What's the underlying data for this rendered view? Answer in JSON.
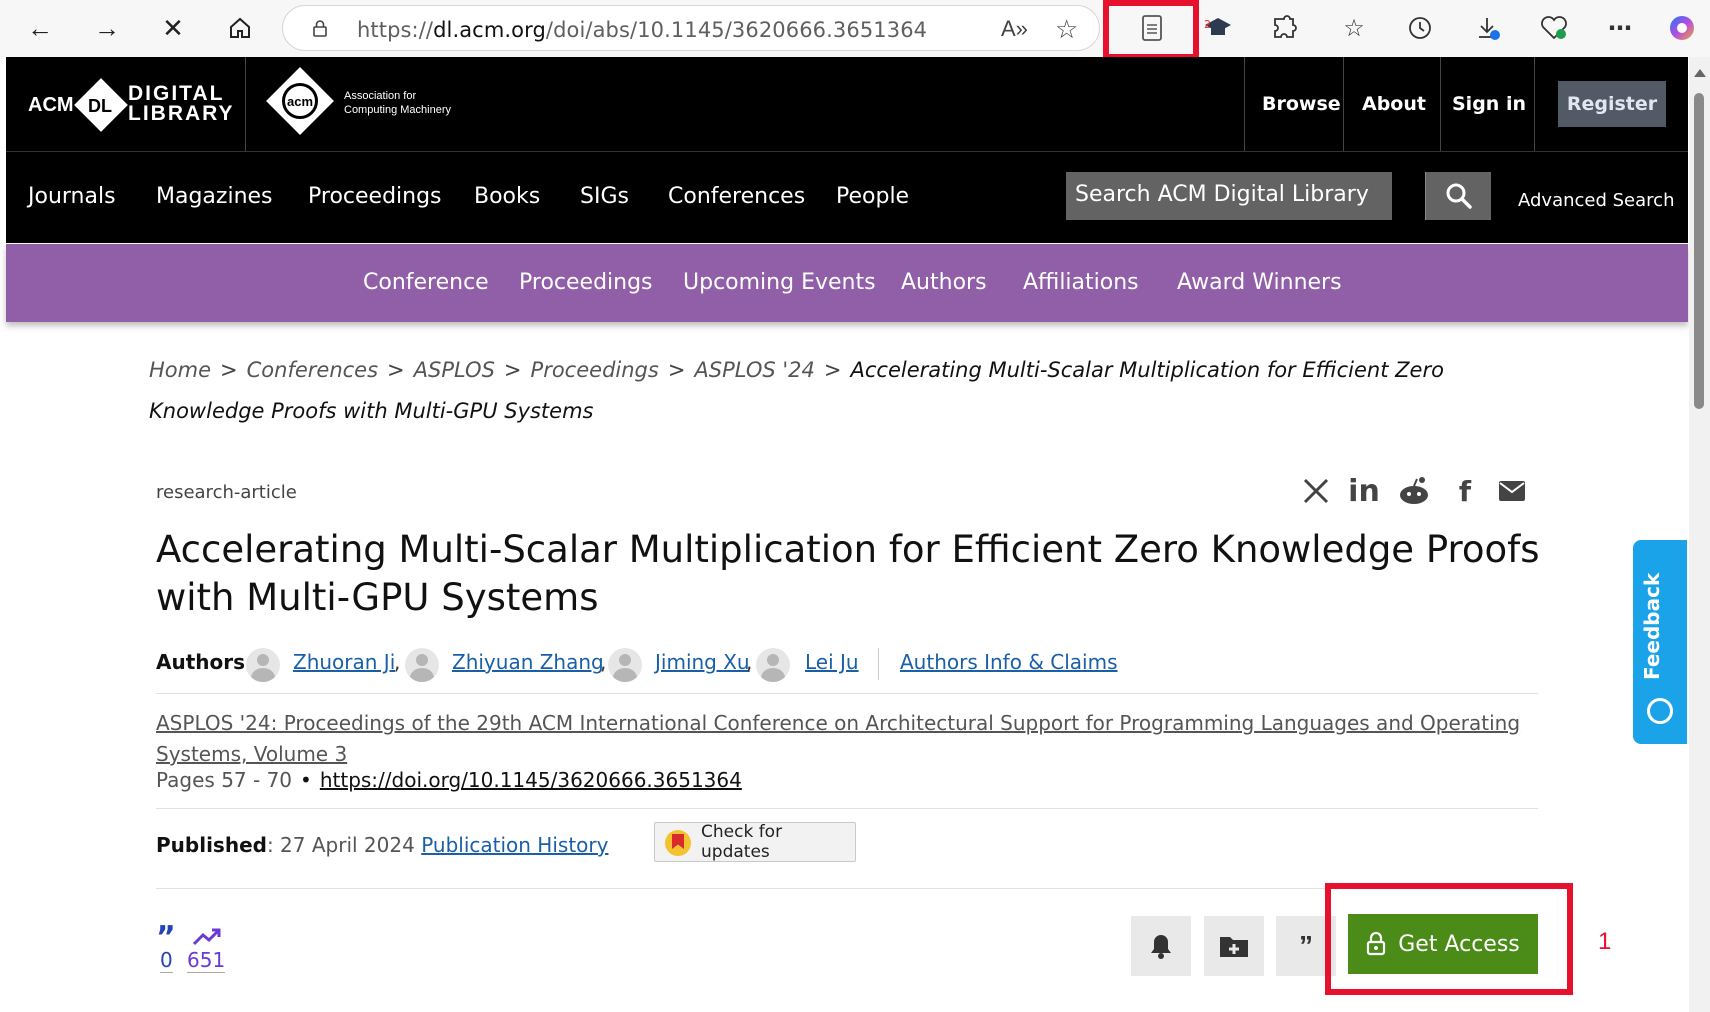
{
  "browser": {
    "url_prefix": "https://",
    "url_host": "dl.acm.org",
    "url_path": "/doi/abs/10.1145/3620666.3651364",
    "read_aloud": "A»"
  },
  "header": {
    "dl_logo_acm": "ACM",
    "dl_logo_mark": "DL",
    "dl_logo_digital": "DIGITAL",
    "dl_logo_library": "LIBRARY",
    "acm_logo_mark": "acm",
    "acm_line1": "Association for",
    "acm_line2": "Computing Machinery",
    "links": [
      "Browse",
      "About",
      "Sign in"
    ],
    "register": "Register"
  },
  "nav": {
    "items": [
      "Journals",
      "Magazines",
      "Proceedings",
      "Books",
      "SIGs",
      "Conferences",
      "People"
    ],
    "search_placeholder": "Search ACM Digital Library",
    "advanced_search": "Advanced Search"
  },
  "subnav": {
    "items": [
      "Conference",
      "Proceedings",
      "Upcoming Events",
      "Authors",
      "Affiliations",
      "Award Winners"
    ]
  },
  "breadcrumb": {
    "items": [
      "Home",
      "Conferences",
      "ASPLOS",
      "Proceedings",
      "ASPLOS '24"
    ],
    "current": "Accelerating Multi-Scalar Multiplication for Efficient Zero Knowledge Proofs with Multi-GPU Systems",
    "separator": ">"
  },
  "article": {
    "type": "research-article",
    "title": "Accelerating Multi-Scalar Multiplication for Efficient Zero Knowledge Proofs with Multi-GPU Systems",
    "authors_label": "Authors",
    "authors": [
      "Zhuoran Ji",
      "Zhiyuan Zhang",
      "Jiming Xu",
      "Lei Ju"
    ],
    "authors_info": "Authors Info & Claims",
    "proceedings": "ASPLOS '24: Proceedings of the 29th ACM International Conference on Architectural Support for Programming Languages and Operating Systems, Volume 3",
    "pages": "Pages 57 - 70",
    "bullet": "•",
    "doi": "https://doi.org/10.1145/3620666.3651364",
    "published_label": "Published",
    "published_date": ": 27 April 2024",
    "publication_history": "Publication History",
    "check_updates": "Check for updates",
    "citations": "0",
    "downloads": "651",
    "get_access": "Get Access"
  },
  "share_icons": [
    "x-icon",
    "linkedin-icon",
    "reddit-icon",
    "facebook-icon",
    "email-icon"
  ],
  "feedback": "Feedback",
  "annotation": "1",
  "colors": {
    "purple": "#915fa8",
    "green": "#4b8b17",
    "link": "#1a5fa8",
    "highlight": "#e8112d",
    "feedback": "#1aa3e8"
  }
}
